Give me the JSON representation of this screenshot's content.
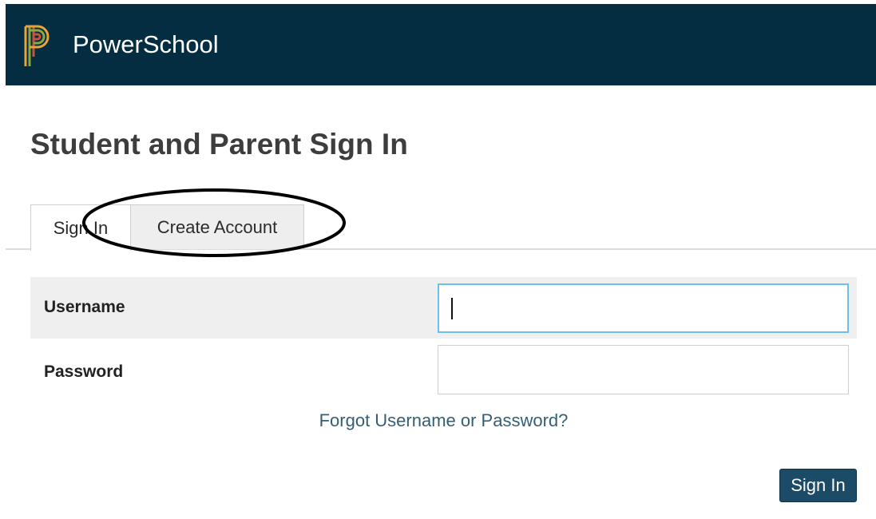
{
  "header": {
    "brand": "PowerSchool",
    "background_color": "#042d42",
    "logo_icon": "powerschool-p-logo-icon"
  },
  "page": {
    "title": "Student and Parent Sign In"
  },
  "tabs": [
    {
      "label": "Sign In",
      "active": true
    },
    {
      "label": "Create Account",
      "active": false,
      "annotated": true
    }
  ],
  "form": {
    "username": {
      "label": "Username",
      "value": "",
      "focused": true
    },
    "password": {
      "label": "Password",
      "value": ""
    },
    "forgot_link": "Forgot Username or Password?",
    "submit_label": "Sign In"
  },
  "colors": {
    "accent": "#1b4b67",
    "link": "#355e75",
    "focus_border": "#6cbfe6"
  }
}
